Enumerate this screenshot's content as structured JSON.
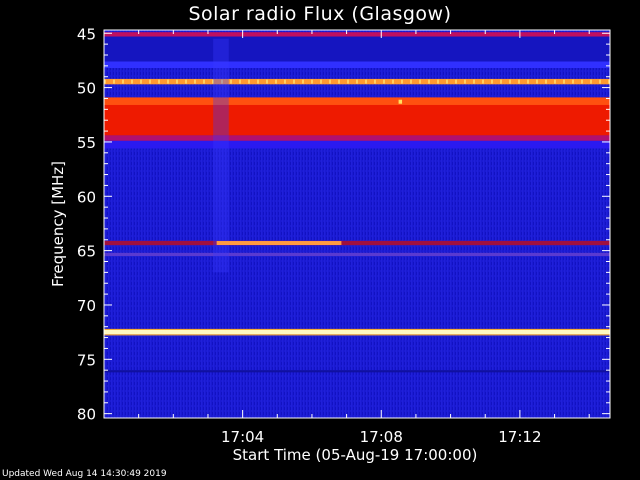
{
  "chart_data": {
    "type": "heatmap",
    "title": "Solar radio Flux (Glasgow)",
    "xlabel": "Start Time (05-Aug-19 17:00:00)",
    "ylabel": "Frequency [MHz]",
    "x_tick_labels": [
      "17:04",
      "17:08",
      "17:12"
    ],
    "x_tick_minutes": [
      4,
      8,
      12
    ],
    "x_range_minutes": [
      0,
      14.6
    ],
    "y_tick_labels": [
      "45",
      "50",
      "55",
      "60",
      "65",
      "70",
      "75",
      "80"
    ],
    "y_tick_values": [
      45,
      50,
      55,
      60,
      65,
      70,
      75,
      80
    ],
    "y_range_mhz": [
      44.7,
      80.4
    ],
    "y_axis_inverted": true,
    "background_color": "#1a1ad2",
    "emission_bands": [
      {
        "from_mhz": 44.9,
        "to_mhz": 45.3,
        "color": "#c01060"
      },
      {
        "from_mhz": 47.6,
        "to_mhz": 48.2,
        "color": "#3030ff"
      },
      {
        "from_mhz": 49.2,
        "to_mhz": 49.7,
        "color": "#ff9a30"
      },
      {
        "from_mhz": 50.9,
        "to_mhz": 51.6,
        "color": "#ff5010"
      },
      {
        "from_mhz": 51.6,
        "to_mhz": 54.4,
        "color": "#ee1a00"
      },
      {
        "from_mhz": 54.4,
        "to_mhz": 54.9,
        "color": "#b01070"
      },
      {
        "from_mhz": 54.9,
        "to_mhz": 55.6,
        "color": "#2a1af0"
      },
      {
        "from_mhz": 64.1,
        "to_mhz": 64.5,
        "color": "#a01040"
      },
      {
        "from_mhz": 65.2,
        "to_mhz": 65.5,
        "color": "#5a3ad0"
      },
      {
        "from_mhz": 72.3,
        "to_mhz": 72.7,
        "color": "#fff8c0"
      },
      {
        "from_mhz": 72.2,
        "to_mhz": 72.3,
        "color": "#ffb030"
      },
      {
        "from_mhz": 72.7,
        "to_mhz": 72.8,
        "color": "#ffb030"
      },
      {
        "from_mhz": 76.0,
        "to_mhz": 76.2,
        "color": "#1010a0"
      }
    ],
    "bursts": [
      {
        "freq_mhz": 64.3,
        "start_minute": 3.25,
        "end_minute": 6.85,
        "color": "#ff9a40"
      },
      {
        "freq_mhz": 51.3,
        "start_minute": 8.5,
        "end_minute": 8.6,
        "color": "#ffe060"
      }
    ]
  },
  "footer": {
    "updated": "Updated Wed Aug 14 14:30:49 2019"
  }
}
